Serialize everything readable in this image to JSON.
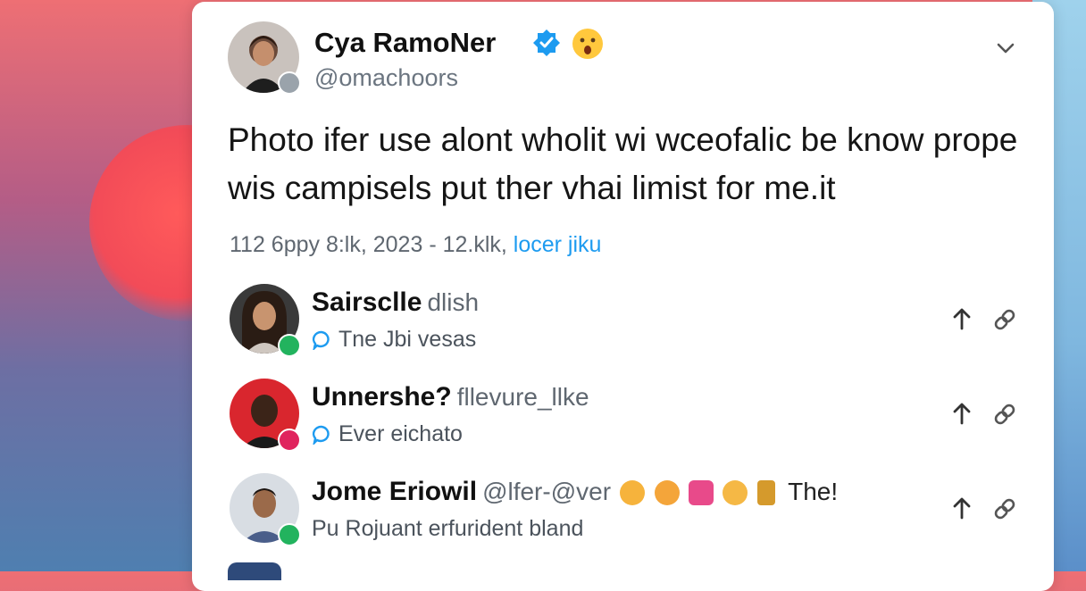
{
  "post": {
    "author_name": "Cya RamoNer",
    "author_handle": "@omachoors",
    "text": "Photo ifer use alont wholit wi wceofalic be know prope wis campisels put ther vhai limist for me.it",
    "meta_text": "112 6ppy 8:lk, 2023 - 12.klk, ",
    "meta_link": "locer jiku"
  },
  "replies": [
    {
      "name": "Sairsclle",
      "handle": "dlish",
      "subtitle": "Tne Jbi vesas"
    },
    {
      "name": "Unnershe?",
      "handle": "fllevure_llke",
      "subtitle": "Ever eichato"
    },
    {
      "name": "Jome Eriowil",
      "handle": "@lfer-@ver",
      "tail": "The!",
      "subtitle": "Pu Rojuant erfurident bland"
    }
  ],
  "colors": {
    "verified": "#1d9bf0",
    "link": "#1d9bf0",
    "badge_green": "#22b35e",
    "badge_red": "#e0245e"
  },
  "icons": [
    "verified-icon",
    "surprised-emoji-icon",
    "chevron-down-icon",
    "reply-bubble-icon",
    "upload-icon",
    "link-icon"
  ]
}
